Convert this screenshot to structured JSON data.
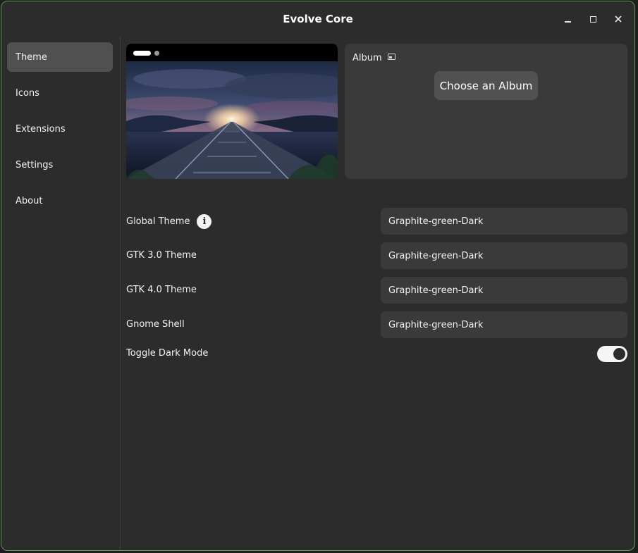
{
  "window": {
    "title": "Evolve Core"
  },
  "titlebar_buttons": {
    "minimize": "minimize-icon",
    "maximize": "maximize-icon",
    "close": "close-icon"
  },
  "sidebar": {
    "items": [
      {
        "label": "Theme",
        "active": true
      },
      {
        "label": "Icons",
        "active": false
      },
      {
        "label": "Extensions",
        "active": false
      },
      {
        "label": "Settings",
        "active": false
      },
      {
        "label": "About",
        "active": false
      }
    ]
  },
  "album": {
    "label": "Album",
    "choose_button": "Choose an Album"
  },
  "settings": {
    "global_theme": {
      "label": "Global Theme",
      "value": "Graphite-green-Dark"
    },
    "gtk3_theme": {
      "label": "GTK 3.0 Theme",
      "value": "Graphite-green-Dark"
    },
    "gtk4_theme": {
      "label": "GTK 4.0 Theme",
      "value": "Graphite-green-Dark"
    },
    "gnome_shell": {
      "label": "Gnome Shell",
      "value": "Graphite-green-Dark"
    },
    "dark_mode": {
      "label": "Toggle Dark Mode",
      "enabled": true
    }
  },
  "colors": {
    "window_bg": "#2c2c2c",
    "border_accent": "#5b9a53",
    "active_item": "#505050",
    "field_bg": "#3a3a3a"
  }
}
